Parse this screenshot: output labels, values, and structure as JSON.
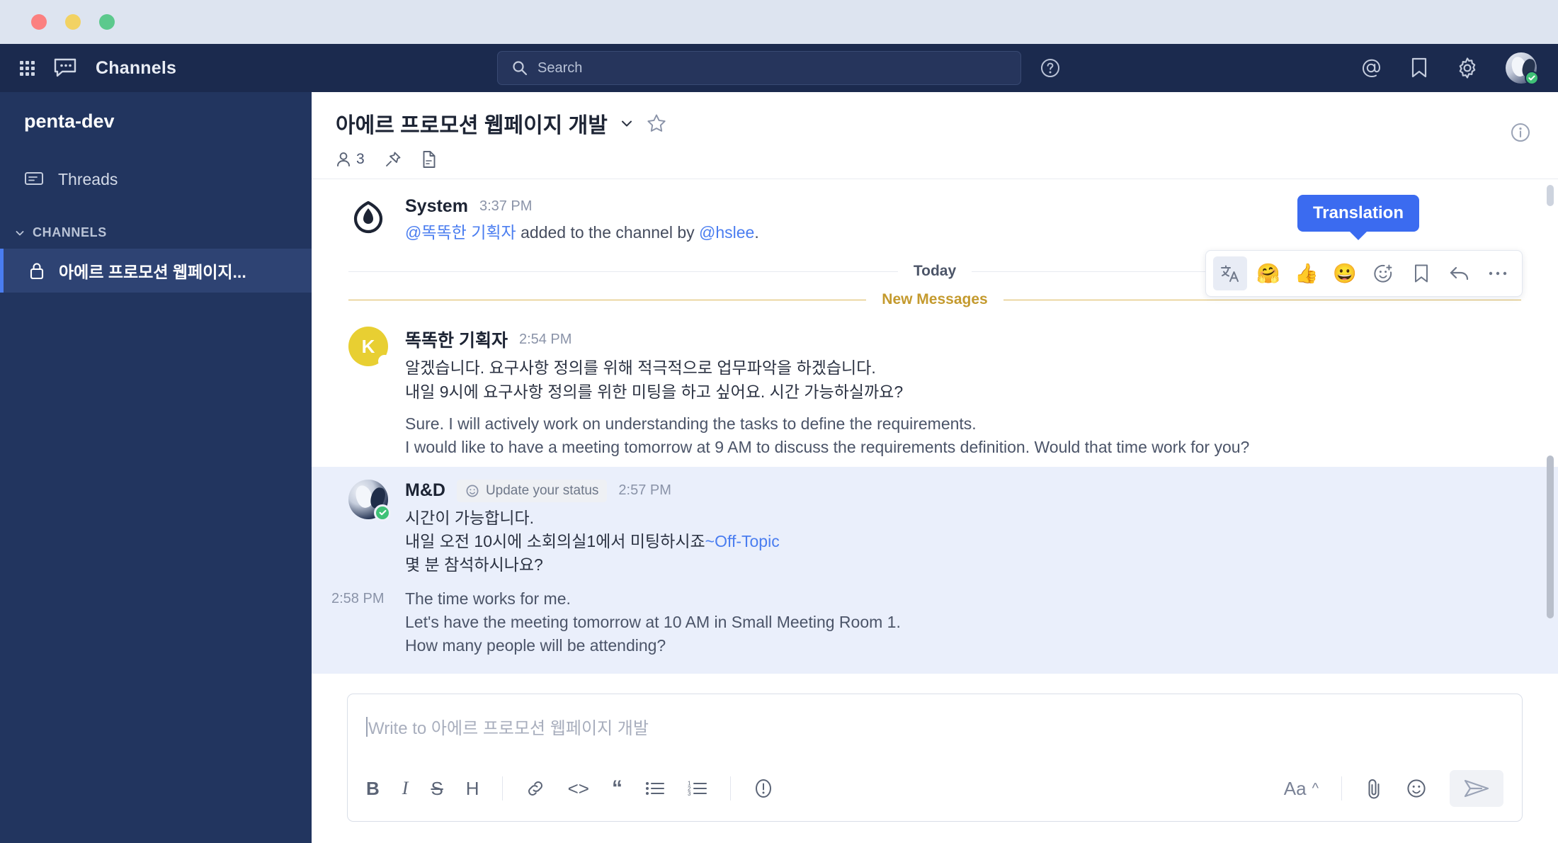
{
  "window": {
    "controls": [
      "close",
      "minimize",
      "maximize"
    ]
  },
  "topbar": {
    "grid_icon": "apps-grid-icon",
    "channels_icon": "channels-chat-icon",
    "channels_label": "Channels",
    "search": {
      "icon": "search-icon",
      "placeholder": "Search",
      "value": ""
    },
    "help_icon": "help-circle-icon",
    "right_icons": [
      {
        "name": "mentions-icon",
        "glyph": "@"
      },
      {
        "name": "saved-items-icon",
        "glyph": "bookmark"
      },
      {
        "name": "settings-gear-icon",
        "glyph": "gear"
      }
    ],
    "avatar": {
      "name": "user-avatar",
      "status": "online"
    }
  },
  "sidebar": {
    "team_name": "penta-dev",
    "items": [
      {
        "label": "Threads",
        "icon": "threads-icon"
      }
    ],
    "section": {
      "label": "CHANNELS",
      "chevron": "chevron-down-icon"
    },
    "channels": [
      {
        "label": "아에르 프로모션 웹페이지...",
        "icon": "lock-icon",
        "active": true
      }
    ]
  },
  "channel_header": {
    "title": "아에르 프로모션 웹페이지 개발",
    "chevron": "chevron-down-icon",
    "star_icon": "star-icon",
    "member_count": "3",
    "member_icon": "members-icon",
    "pin_icon": "pin-icon",
    "file_icon": "file-icon",
    "info_icon": "info-circle-icon"
  },
  "dividers": {
    "today": "Today",
    "new_messages": "New Messages"
  },
  "messages": [
    {
      "author": "System",
      "time": "3:37 PM",
      "avatar": "system-logo-avatar",
      "segments": [
        {
          "text": "@똑똑한 기획자",
          "style": "mention"
        },
        {
          "text": " added to the channel by ",
          "style": "plain"
        },
        {
          "text": "@hslee",
          "style": "mention"
        },
        {
          "text": ".",
          "style": "plain"
        }
      ]
    },
    {
      "author": "똑똑한 기획자",
      "time": "2:54 PM",
      "avatar_letter": "K",
      "lines": [
        "알겠습니다. 요구사항 정의를 위해 적극적으로 업무파악을 하겠습니다.",
        "내일 9시에 요구사항 정의를 위한 미팅을 하고 싶어요. 시간 가능하실까요?"
      ],
      "translation": [
        "Sure. I will actively work on understanding the tasks to define the requirements.",
        "I would like to have a meeting tomorrow at 9 AM to discuss the requirements definition. Would that time work for you?"
      ]
    },
    {
      "author": "M&D",
      "time": "2:57 PM",
      "status_badge": {
        "icon": "status-emoji-icon",
        "label": "Update your status"
      },
      "line1": "시간이 가능합니다.",
      "line2_pre": "내일 오전 10시에 소회의실1에서 미팅하시죠",
      "line2_link": "~Off-Topic",
      "line3": "몇 분 참석하시나요?",
      "translation_time": "2:58 PM",
      "translation": [
        "The time works for me.",
        "Let's have the meeting tomorrow at 10 AM in Small Meeting Room 1.",
        "How many people will be attending?"
      ]
    }
  ],
  "hover_toolbar": {
    "tooltip": "Translation",
    "buttons": [
      {
        "name": "translate-icon",
        "glyph": "文",
        "active": true
      },
      {
        "name": "hugging-face-emoji",
        "glyph": "🤗",
        "active": false
      },
      {
        "name": "thumbs-up-emoji",
        "glyph": "👍",
        "active": false
      },
      {
        "name": "grinning-face-emoji",
        "glyph": "😀",
        "active": false
      },
      {
        "name": "add-reaction-icon",
        "glyph": "emoji-plus",
        "active": false
      },
      {
        "name": "save-message-icon",
        "glyph": "bookmark",
        "active": false
      },
      {
        "name": "reply-icon",
        "glyph": "reply",
        "active": false
      },
      {
        "name": "more-options-icon",
        "glyph": "•••",
        "active": false
      }
    ]
  },
  "composer": {
    "placeholder": "Write to 아에르 프로모션 웹페이지 개발",
    "value": "",
    "format_tools": [
      {
        "name": "bold-button",
        "label": "B"
      },
      {
        "name": "italic-button",
        "label": "I"
      },
      {
        "name": "strikethrough-button",
        "label": "S"
      },
      {
        "name": "heading-button",
        "label": "H"
      },
      {
        "name": "link-button",
        "label": "link"
      },
      {
        "name": "code-button",
        "label": "<>"
      },
      {
        "name": "quote-button",
        "label": "“"
      },
      {
        "name": "bullet-list-button",
        "label": "bullets"
      },
      {
        "name": "numbered-list-button",
        "label": "numbers"
      },
      {
        "name": "info-button",
        "label": "info"
      }
    ],
    "right_tools": {
      "font_label": "Aa",
      "font_chevron": "^",
      "attach_icon": "paperclip-icon",
      "emoji_icon": "emoji-icon",
      "send_icon": "send-icon"
    }
  },
  "colors": {
    "navy": "#22355f",
    "topbar": "#1b2a4e",
    "accent_blue": "#4a7df0",
    "tooltip_blue": "#3b6bf0",
    "highlight_bg": "#eaeffb",
    "new_messages": "#c49a2e",
    "online_green": "#3fc177",
    "avatar_yellow": "#e8cf32"
  }
}
